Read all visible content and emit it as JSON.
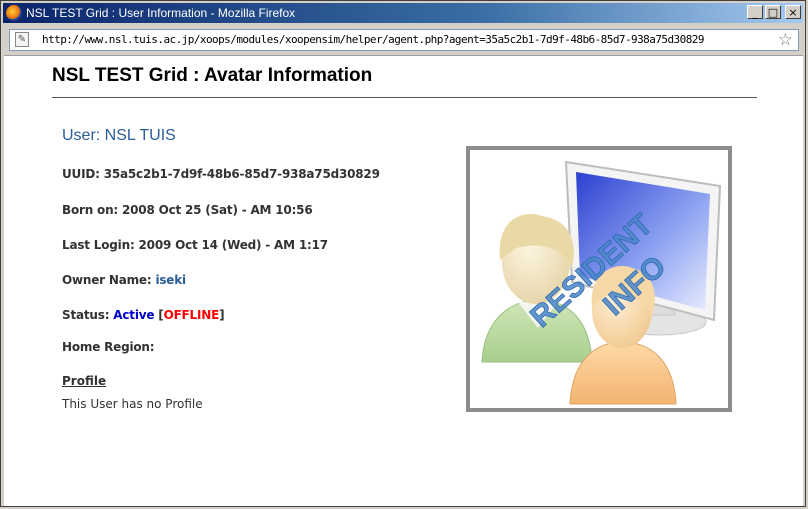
{
  "window": {
    "title": "NSL TEST Grid : User Information - Mozilla Firefox",
    "controls": {
      "minimize": "_",
      "maximize": "□",
      "close": "×"
    }
  },
  "browser": {
    "url": "http://www.nsl.tuis.ac.jp/xoops/modules/xoopensim/helper/agent.php?agent=35a5c2b1-7d9f-48b6-85d7-938a75d30829"
  },
  "page": {
    "title": "NSL TEST Grid : Avatar Information",
    "user_heading": "User: NSL  TUIS",
    "uuid_label": "UUID: ",
    "uuid_value": "35a5c2b1-7d9f-48b6-85d7-938a75d30829",
    "born_label": "Born on: ",
    "born_value": "2008 Oct 25 (Sat) - AM 10:56",
    "last_login_label": "Last Login: ",
    "last_login_value": "2009 Oct 14 (Wed) - AM 1:17",
    "owner_label": "Owner Name: ",
    "owner_value": "iseki",
    "status_label": "Status: ",
    "status_active": "Active",
    "status_open": " [",
    "status_offline": "OFFLINE",
    "status_close": "]",
    "home_region_label": "Home Region:",
    "profile_heading": "Profile",
    "profile_text": "This User has no Profile",
    "avatar_image": {
      "line1": "RESIDENT",
      "line2": "INFO"
    }
  },
  "colors": {
    "link_blue": "#2a5d99",
    "active": "#0000cc",
    "offline": "#ff0000",
    "watermark": "#4a86c8"
  }
}
